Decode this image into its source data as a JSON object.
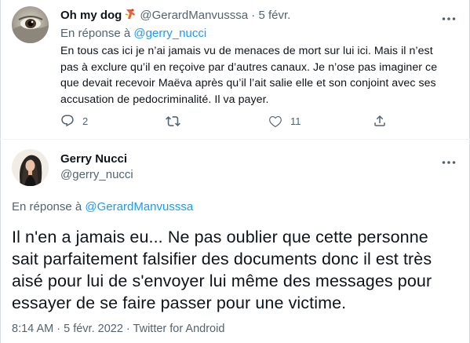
{
  "reply_tweet": {
    "display_name": "Oh my dog",
    "badge_icon": "dog-emoji-icon",
    "handle": "@GerardManvusssa",
    "separator": "·",
    "date": "5 févr.",
    "reply_prefix": "En réponse à",
    "reply_to_handle": "@gerry_nucci",
    "body": "En tous cas ici je n’ai jamais vu de menaces de mort sur lui ici. Mais il n’est pas à exclure qu’il en reçoive par d’autres canaux. Je n’ose pas imaginer ce que devait recevoir Maëva après qu’il l’ait salie elle et son conjoint avec ses accusation de pedocriminalité. Il va payer.",
    "actions": {
      "reply_count": "2",
      "retweet_count": "",
      "like_count": "11",
      "share_count": ""
    }
  },
  "main_tweet": {
    "display_name": "Gerry Nucci",
    "handle": "@gerry_nucci",
    "reply_prefix": "En réponse à",
    "reply_to_handle": "@GerardManvusssa",
    "body": "Il n'en a jamais eu... Ne pas oublier que cette personne sait parfaitement falsifier des documents donc il est très aisé pour lui de s'envoyer lui même des messages pour essayer de se faire passer pour une victime.",
    "time": "8:14 AM",
    "separator": "·",
    "date": "5 févr. 2022",
    "source": "Twitter for Android"
  },
  "colors": {
    "text_primary": "#0f1419",
    "text_secondary": "#536471",
    "link": "#1d9bf0",
    "divider": "#eff3f4"
  }
}
